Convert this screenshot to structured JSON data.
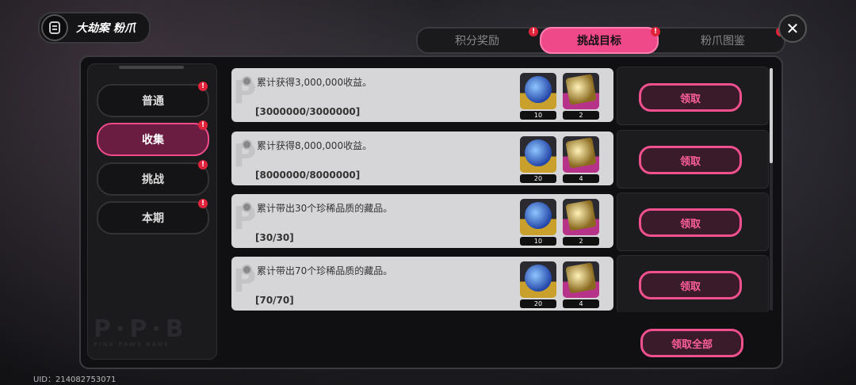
{
  "header": {
    "title": "大劫案 粉爪",
    "close_symbol": "✕"
  },
  "tabs": [
    {
      "label": "积分奖励",
      "active": false,
      "alert": "!"
    },
    {
      "label": "挑战目标",
      "active": true,
      "alert": "!"
    },
    {
      "label": "粉爪图鉴",
      "active": false,
      "alert": "!"
    }
  ],
  "sidebar": {
    "items": [
      {
        "label": "普通",
        "active": false,
        "alert": "!"
      },
      {
        "label": "收集",
        "active": true,
        "alert": "!"
      },
      {
        "label": "挑战",
        "active": false,
        "alert": "!"
      },
      {
        "label": "本期",
        "active": false,
        "alert": "!"
      }
    ],
    "watermark": "P·P·B",
    "watermark_sub": "PINK PAWS BANK"
  },
  "tasks": [
    {
      "desc": "累计获得3,000,000收益。",
      "progress": "[3000000/3000000]",
      "reward1_count": "10",
      "reward2_count": "2",
      "claim_label": "领取"
    },
    {
      "desc": "累计获得8,000,000收益。",
      "progress": "[8000000/8000000]",
      "reward1_count": "20",
      "reward2_count": "4",
      "claim_label": "领取"
    },
    {
      "desc": "累计带出30个珍稀品质的藏品。",
      "progress": "[30/30]",
      "reward1_count": "10",
      "reward2_count": "2",
      "claim_label": "领取"
    },
    {
      "desc": "累计带出70个珍稀品质的藏品。",
      "progress": "[70/70]",
      "reward1_count": "20",
      "reward2_count": "4",
      "claim_label": "领取"
    }
  ],
  "claim_all_label": "领取全部",
  "uid": "UID：214082753071",
  "colors": {
    "accent": "#f0498a",
    "alert": "#e0233a"
  }
}
